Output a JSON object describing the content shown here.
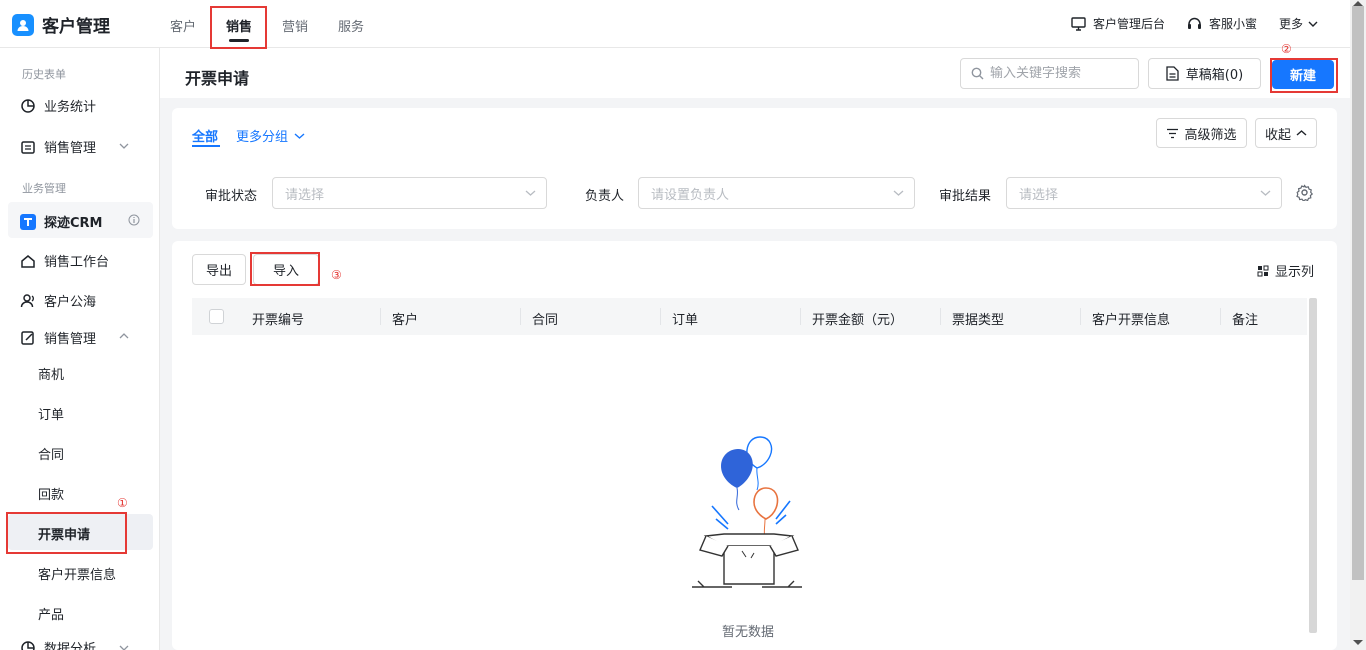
{
  "app": {
    "title": "客户管理"
  },
  "nav": {
    "tabs": [
      "客户",
      "销售",
      "营销",
      "服务"
    ],
    "active_index": 1
  },
  "topbar_right": {
    "admin": "客户管理后台",
    "service": "客服小蜜",
    "more": "更多"
  },
  "sidebar": {
    "section_history": "历史表单",
    "item_stats": "业务统计",
    "item_sales_mgmt_1": "销售管理",
    "section_business": "业务管理",
    "crm_name": "探迹CRM",
    "item_workbench": "销售工作台",
    "item_pool": "客户公海",
    "item_sales_mgmt_2": "销售管理",
    "sub_items": [
      "商机",
      "订单",
      "合同",
      "回款",
      "开票申请",
      "客户开票信息",
      "产品"
    ],
    "active_sub": "开票申请",
    "item_analysis": "数据分析"
  },
  "header": {
    "page_title": "开票申请",
    "search_placeholder": "输入关键字搜索",
    "drafts": "草稿箱(0)",
    "new": "新建"
  },
  "filters": {
    "tab_all": "全部",
    "tab_more": "更多分组",
    "advanced": "高级筛选",
    "collapse": "收起",
    "approval_status_label": "审批状态",
    "approval_status_placeholder": "请选择",
    "owner_label": "负责人",
    "owner_placeholder": "请设置负责人",
    "approval_result_label": "审批结果",
    "approval_result_placeholder": "请选择"
  },
  "table": {
    "export": "导出",
    "import": "导入",
    "show_columns": "显示列",
    "columns": [
      "开票编号",
      "客户",
      "合同",
      "订单",
      "开票金额（元）",
      "票据类型",
      "客户开票信息",
      "备注"
    ],
    "empty": "暂无数据"
  },
  "annotations": {
    "n1": "①",
    "n2": "②",
    "n3": "③"
  },
  "colors": {
    "primary": "#1677ff",
    "annotation": "#e53935",
    "brand": "#1890ff"
  }
}
